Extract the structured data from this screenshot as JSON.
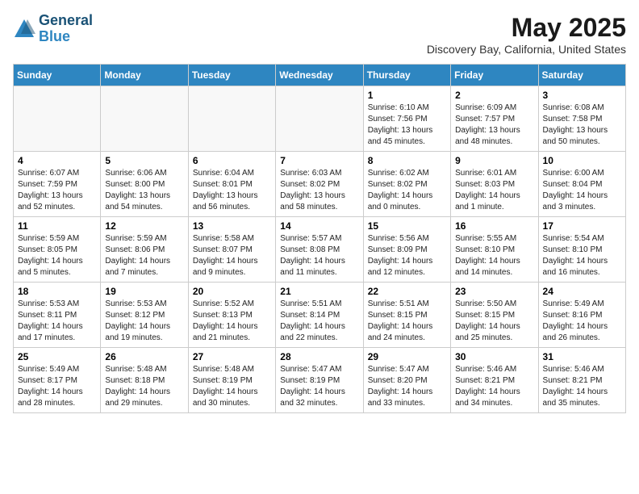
{
  "logo": {
    "line1": "General",
    "line2": "Blue"
  },
  "title": "May 2025",
  "subtitle": "Discovery Bay, California, United States",
  "weekdays": [
    "Sunday",
    "Monday",
    "Tuesday",
    "Wednesday",
    "Thursday",
    "Friday",
    "Saturday"
  ],
  "weeks": [
    [
      {
        "day": "",
        "info": ""
      },
      {
        "day": "",
        "info": ""
      },
      {
        "day": "",
        "info": ""
      },
      {
        "day": "",
        "info": ""
      },
      {
        "day": "1",
        "info": "Sunrise: 6:10 AM\nSunset: 7:56 PM\nDaylight: 13 hours\nand 45 minutes."
      },
      {
        "day": "2",
        "info": "Sunrise: 6:09 AM\nSunset: 7:57 PM\nDaylight: 13 hours\nand 48 minutes."
      },
      {
        "day": "3",
        "info": "Sunrise: 6:08 AM\nSunset: 7:58 PM\nDaylight: 13 hours\nand 50 minutes."
      }
    ],
    [
      {
        "day": "4",
        "info": "Sunrise: 6:07 AM\nSunset: 7:59 PM\nDaylight: 13 hours\nand 52 minutes."
      },
      {
        "day": "5",
        "info": "Sunrise: 6:06 AM\nSunset: 8:00 PM\nDaylight: 13 hours\nand 54 minutes."
      },
      {
        "day": "6",
        "info": "Sunrise: 6:04 AM\nSunset: 8:01 PM\nDaylight: 13 hours\nand 56 minutes."
      },
      {
        "day": "7",
        "info": "Sunrise: 6:03 AM\nSunset: 8:02 PM\nDaylight: 13 hours\nand 58 minutes."
      },
      {
        "day": "8",
        "info": "Sunrise: 6:02 AM\nSunset: 8:02 PM\nDaylight: 14 hours\nand 0 minutes."
      },
      {
        "day": "9",
        "info": "Sunrise: 6:01 AM\nSunset: 8:03 PM\nDaylight: 14 hours\nand 1 minute."
      },
      {
        "day": "10",
        "info": "Sunrise: 6:00 AM\nSunset: 8:04 PM\nDaylight: 14 hours\nand 3 minutes."
      }
    ],
    [
      {
        "day": "11",
        "info": "Sunrise: 5:59 AM\nSunset: 8:05 PM\nDaylight: 14 hours\nand 5 minutes."
      },
      {
        "day": "12",
        "info": "Sunrise: 5:59 AM\nSunset: 8:06 PM\nDaylight: 14 hours\nand 7 minutes."
      },
      {
        "day": "13",
        "info": "Sunrise: 5:58 AM\nSunset: 8:07 PM\nDaylight: 14 hours\nand 9 minutes."
      },
      {
        "day": "14",
        "info": "Sunrise: 5:57 AM\nSunset: 8:08 PM\nDaylight: 14 hours\nand 11 minutes."
      },
      {
        "day": "15",
        "info": "Sunrise: 5:56 AM\nSunset: 8:09 PM\nDaylight: 14 hours\nand 12 minutes."
      },
      {
        "day": "16",
        "info": "Sunrise: 5:55 AM\nSunset: 8:10 PM\nDaylight: 14 hours\nand 14 minutes."
      },
      {
        "day": "17",
        "info": "Sunrise: 5:54 AM\nSunset: 8:10 PM\nDaylight: 14 hours\nand 16 minutes."
      }
    ],
    [
      {
        "day": "18",
        "info": "Sunrise: 5:53 AM\nSunset: 8:11 PM\nDaylight: 14 hours\nand 17 minutes."
      },
      {
        "day": "19",
        "info": "Sunrise: 5:53 AM\nSunset: 8:12 PM\nDaylight: 14 hours\nand 19 minutes."
      },
      {
        "day": "20",
        "info": "Sunrise: 5:52 AM\nSunset: 8:13 PM\nDaylight: 14 hours\nand 21 minutes."
      },
      {
        "day": "21",
        "info": "Sunrise: 5:51 AM\nSunset: 8:14 PM\nDaylight: 14 hours\nand 22 minutes."
      },
      {
        "day": "22",
        "info": "Sunrise: 5:51 AM\nSunset: 8:15 PM\nDaylight: 14 hours\nand 24 minutes."
      },
      {
        "day": "23",
        "info": "Sunrise: 5:50 AM\nSunset: 8:15 PM\nDaylight: 14 hours\nand 25 minutes."
      },
      {
        "day": "24",
        "info": "Sunrise: 5:49 AM\nSunset: 8:16 PM\nDaylight: 14 hours\nand 26 minutes."
      }
    ],
    [
      {
        "day": "25",
        "info": "Sunrise: 5:49 AM\nSunset: 8:17 PM\nDaylight: 14 hours\nand 28 minutes."
      },
      {
        "day": "26",
        "info": "Sunrise: 5:48 AM\nSunset: 8:18 PM\nDaylight: 14 hours\nand 29 minutes."
      },
      {
        "day": "27",
        "info": "Sunrise: 5:48 AM\nSunset: 8:19 PM\nDaylight: 14 hours\nand 30 minutes."
      },
      {
        "day": "28",
        "info": "Sunrise: 5:47 AM\nSunset: 8:19 PM\nDaylight: 14 hours\nand 32 minutes."
      },
      {
        "day": "29",
        "info": "Sunrise: 5:47 AM\nSunset: 8:20 PM\nDaylight: 14 hours\nand 33 minutes."
      },
      {
        "day": "30",
        "info": "Sunrise: 5:46 AM\nSunset: 8:21 PM\nDaylight: 14 hours\nand 34 minutes."
      },
      {
        "day": "31",
        "info": "Sunrise: 5:46 AM\nSunset: 8:21 PM\nDaylight: 14 hours\nand 35 minutes."
      }
    ]
  ]
}
